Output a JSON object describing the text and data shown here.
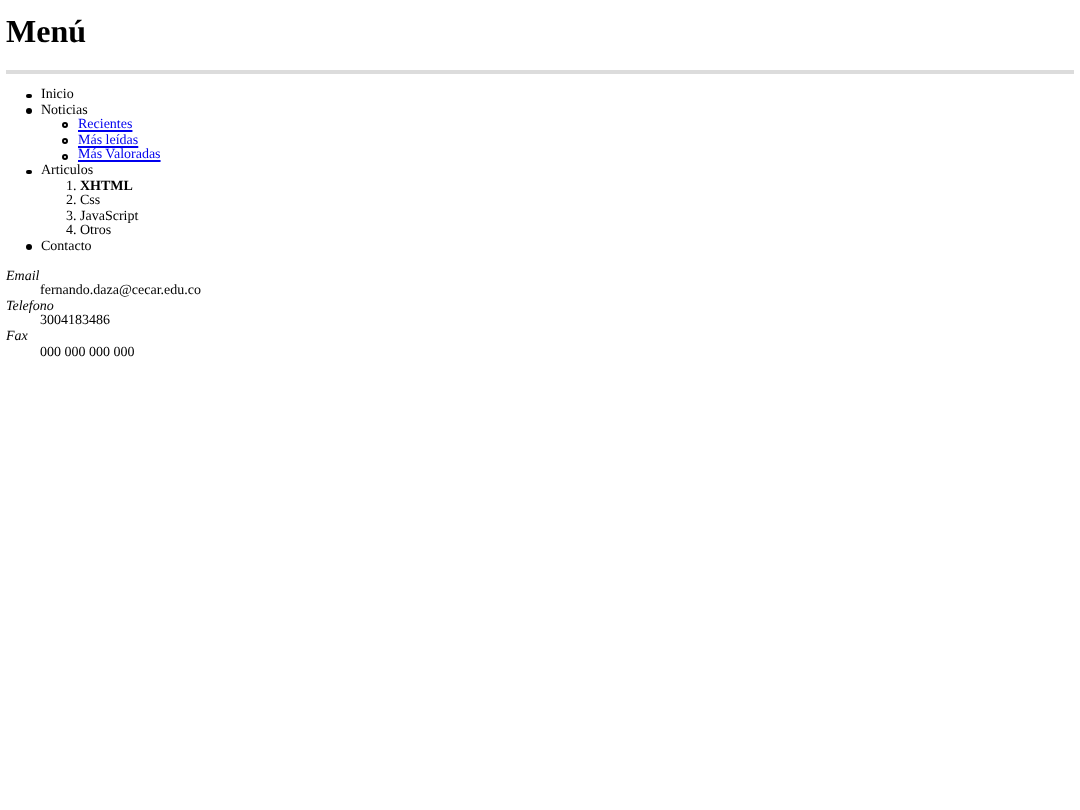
{
  "title": "Menú",
  "menu": [
    {
      "label": "Inicio"
    },
    {
      "label": "Noticias",
      "children": [
        {
          "label": "Recientes",
          "kind": "link"
        },
        {
          "label": "Más leídas",
          "kind": "link"
        },
        {
          "label": "Más Valoradas",
          "kind": "link"
        }
      ]
    },
    {
      "label": "Articulos",
      "ordered": [
        {
          "number": "1.",
          "label": "XHTML",
          "bold": true
        },
        {
          "number": "2.",
          "label": "Css",
          "bold": false
        },
        {
          "number": "3.",
          "label": "JavaScript",
          "bold": false
        },
        {
          "number": "4.",
          "label": "Otros",
          "bold": false
        }
      ]
    },
    {
      "label": "Contacto"
    }
  ],
  "contact": [
    {
      "term": "Email",
      "value": "fernando.daza@cecar.edu.co"
    },
    {
      "term": "Telefono",
      "value": "3004183486"
    },
    {
      "term": "Fax",
      "value": "000 000 000 000"
    }
  ]
}
